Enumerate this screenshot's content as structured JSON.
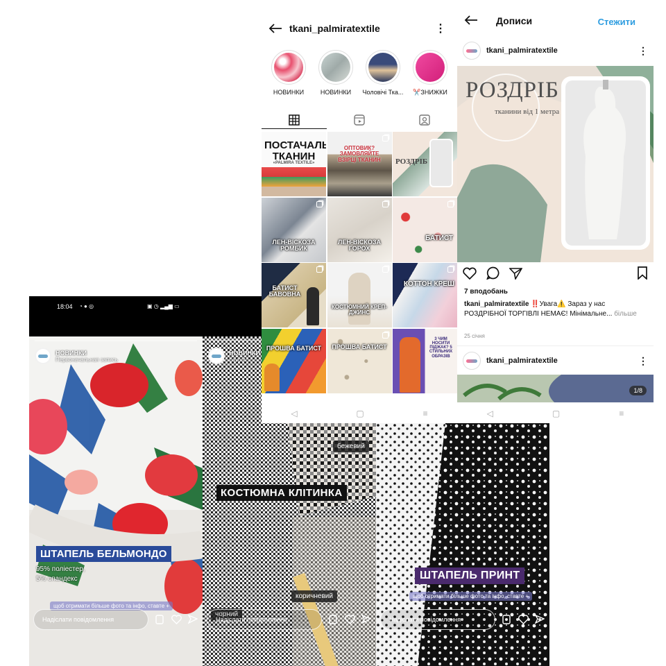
{
  "status_bar": {
    "time": "18:04"
  },
  "story1": {
    "user": "НОВИНКИ",
    "sub": "Первоначальная запись",
    "title": "ШТАПЕЛЬ БЕЛЬМОНДО",
    "line1": "95% поліестер,",
    "line2": "5% спандекс",
    "note": "щоб отримати більше фото та інфо, ставте +",
    "reply_placeholder": "Надіслати повідомлення"
  },
  "story2": {
    "user": "НОВИНКИ",
    "sub": "Layout",
    "title": "КОСТЮМНА КЛІТИНКА",
    "tag_beige": "бежевий",
    "tag_brown": "коричневий",
    "tag_black": "чорний",
    "reply_placeholder": "Надіслати повідомлення"
  },
  "story3": {
    "title": "ШТАПЕЛЬ ПРИНТ",
    "note": "щоб отримати більше фото та інфо, ставте +",
    "reply_placeholder": "Надіслати повідомлення"
  },
  "profile": {
    "username": "tkani_palmiratextile",
    "highlights": [
      {
        "label": "НОВИНКИ",
        "color": "#e8a4b4"
      },
      {
        "label": "НОВИНКИ",
        "color": "#b8c9c9"
      },
      {
        "label": "Чоловічі Тка...",
        "color": "#394a78"
      },
      {
        "label": "✂️ЗНИЖКИ",
        "color": "#e0358c"
      }
    ],
    "tiles": [
      {
        "text": "ПОСТАЧАЛЬНИК ТКАНИН",
        "sub": "«PALMIRA TEXTILE»"
      },
      {
        "text": "ОПТОВИК? ЗАМОВЛЯЙТЕ ВЗІРЦІ ТКАНИН"
      },
      {
        "text": "РОЗДРІБ"
      },
      {
        "text": "ЛЕН-ВІСКОЗА РОМБИК"
      },
      {
        "text": "ЛЕН-ВІСКОЗА ГОРОХ"
      },
      {
        "text": "БАТИСТ"
      },
      {
        "text": "БАТИСТ БАВОВНА"
      },
      {
        "text": "КОСТЮМНИЙ КРЕП-ДЖИНС"
      },
      {
        "text": "КОТТОН КРЕШ"
      },
      {
        "text": "ПРОШВА БАТИСТ"
      },
      {
        "text": "ПРОШВА БАТИСТ"
      },
      {
        "text": "3 ЧИМ НОСИТИ ПІДЖАК? 5 СТИЛЬНИХ ОБРАЗІВ"
      }
    ]
  },
  "posts": {
    "title": "Дописи",
    "follow": "Стежити",
    "username": "tkani_palmiratextile",
    "image_title": "РОЗДРІБ",
    "image_sub": "тканини від 1 метра",
    "likes": "7 вподобань",
    "caption_user": "tkani_palmiratextile",
    "caption_text": " ‼️Увага⚠️ Зараз у нас РОЗДРІБНОЇ ТОРГІВЛІ НЕМАЄ! Мінімальне...",
    "more": "більше",
    "date": "25 січня",
    "next_user": "tkani_palmiratextile",
    "counter": "1/8"
  }
}
